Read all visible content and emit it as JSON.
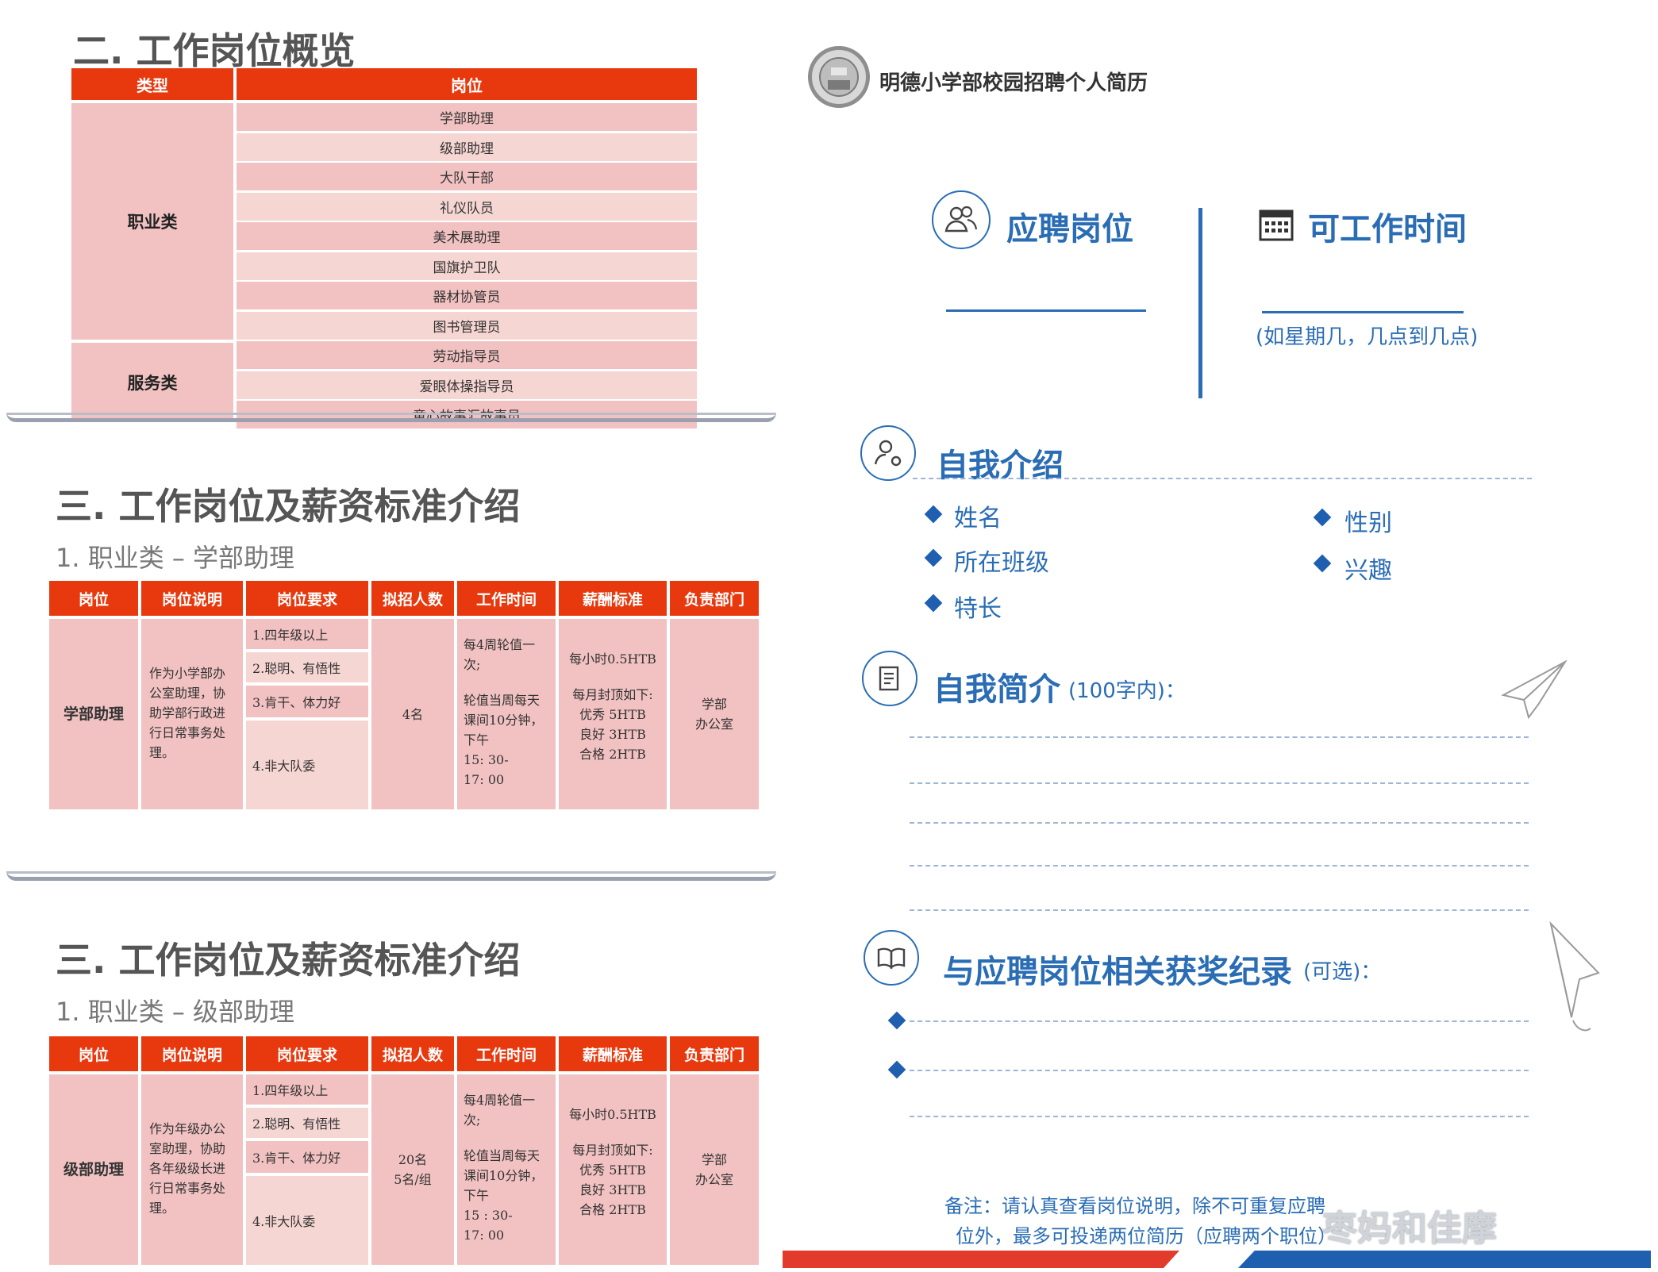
{
  "overview": {
    "title": "二. 工作岗位概览",
    "col_type": "类型",
    "col_position": "岗位",
    "categories": [
      "职业类",
      "服务类"
    ],
    "positions": [
      "学部助理",
      "级部助理",
      "大队干部",
      "礼仪队员",
      "美术展助理",
      "国旗护卫队",
      "器材协管员",
      "图书管理员",
      "劳动指导员",
      "爱眼体操指导员",
      "童心故事汇故事员"
    ]
  },
  "table_headers": [
    "岗位",
    "岗位说明",
    "岗位要求",
    "拟招人数",
    "工作时间",
    "薪酬标准",
    "负责部门"
  ],
  "section1": {
    "title": "三. 工作岗位及薪资标准介绍",
    "subtitle": "1. 职业类 – 学部助理",
    "position": "学部助理",
    "description": "作为小学部办公室助理，协助学部行政进行日常事务处理。",
    "requirements": [
      "1.四年级以上",
      "2.聪明、有悟性",
      "3.肯干、体力好",
      "4.非大队委"
    ],
    "count": "4名",
    "time_a": "每4周轮值一次;",
    "time_b": "轮值当周每天课间10分钟，下午",
    "time_c": "15: 30-",
    "time_d": "17: 00",
    "salary_a": "每小时0.5HTB",
    "salary_b": "每月封顶如下:",
    "salary_c": "优秀 5HTB",
    "salary_d": "良好 3HTB",
    "salary_e": "合格 2HTB",
    "dept_a": "学部",
    "dept_b": "办公室"
  },
  "section2": {
    "title": "三. 工作岗位及薪资标准介绍",
    "subtitle": "1. 职业类 – 级部助理",
    "position": "级部助理",
    "description": "作为年级办公室助理，协助各年级级长进行日常事务处理。",
    "requirements": [
      "1.四年级以上",
      "2.聪明、有悟性",
      "3.肯干、体力好",
      "4.非大队委"
    ],
    "count_a": "20名",
    "count_b": "5名/组",
    "time_a": "每4周轮值一次;",
    "time_b": "轮值当周每天课间10分钟，下午",
    "time_c": "15 : 30-",
    "time_d": "17: 00",
    "salary_a": "每小时0.5HTB",
    "salary_b": "每月封顶如下:",
    "salary_c": "优秀 5HTB",
    "salary_d": "良好 3HTB",
    "salary_e": "合格 2HTB",
    "dept_a": "学部",
    "dept_b": "办公室"
  },
  "resume": {
    "school_title": "明德小学部校园招聘个人简历",
    "apply_position": "应聘岗位",
    "work_time": "可工作时间",
    "work_time_hint": "(如星期几，几点到几点)",
    "self_intro": "自我介绍",
    "fields_left": [
      "姓名",
      "所在班级",
      "特长"
    ],
    "fields_right": [
      "性别",
      "兴趣"
    ],
    "self_summary": "自我简介",
    "self_summary_hint": "(100字内)：",
    "awards": "与应聘岗位相关获奖纪录",
    "awards_hint": "(可选)：",
    "note_line1": "备注：请认真查看岗位说明，除不可重复应聘",
    "note_line2": "位外，最多可投递两位简历（应聘两个职位）",
    "watermark": "枣妈和佳摩"
  },
  "colors": {
    "header_red": "#e8380d",
    "cell_pink": "#f2c2c2",
    "blue": "#2a6db5"
  }
}
